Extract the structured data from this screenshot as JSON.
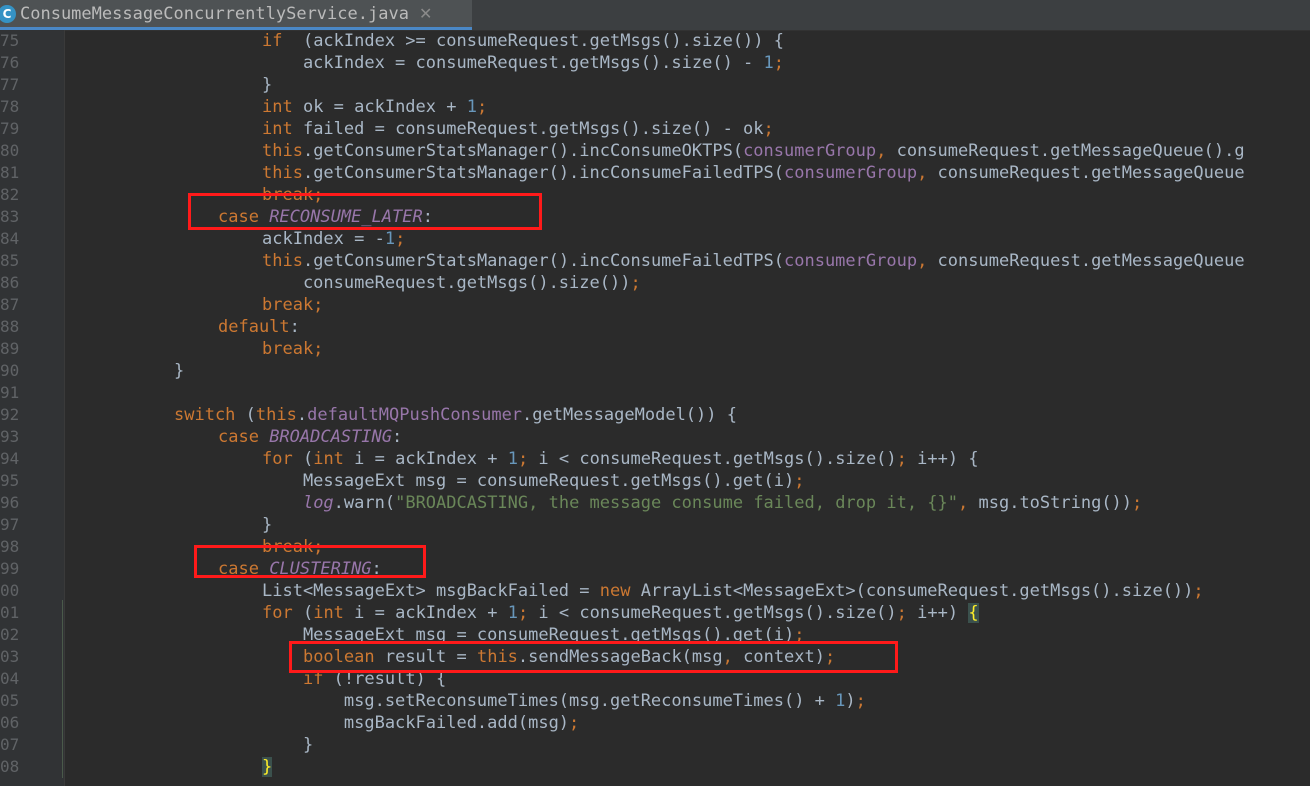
{
  "tab": {
    "icon_letter": "C",
    "filename": "ConsumeMessageConcurrentlyService.java",
    "close_glyph": "✕"
  },
  "line_numbers": [
    "75",
    "76",
    "77",
    "78",
    "79",
    "80",
    "81",
    "82",
    "83",
    "84",
    "85",
    "86",
    "87",
    "88",
    "89",
    "90",
    "91",
    "92",
    "93",
    "94",
    "95",
    "96",
    "97",
    "98",
    "99",
    "00",
    "01",
    "02",
    "03",
    "04",
    "05",
    "06",
    "07",
    "08"
  ],
  "code_lines": [
    [
      [
        "kw",
        "if"
      ],
      [
        "",
        "  (ackIndex >= consumeRequest.getMsgs().size()) {"
      ]
    ],
    [
      [
        "",
        "    ackIndex = consumeRequest.getMsgs().size() - "
      ],
      [
        "num",
        "1"
      ],
      [
        "kw",
        ";"
      ]
    ],
    [
      [
        "",
        "}"
      ]
    ],
    [
      [
        "kw",
        "int"
      ],
      [
        "",
        " ok = ackIndex + "
      ],
      [
        "num",
        "1"
      ],
      [
        "kw",
        ";"
      ]
    ],
    [
      [
        "kw",
        "int"
      ],
      [
        "",
        " failed = consumeRequest.getMsgs().size() - ok"
      ],
      [
        "kw",
        ";"
      ]
    ],
    [
      [
        "kw",
        "this"
      ],
      [
        "",
        ".getConsumerStatsManager().incConsumeOKTPS("
      ],
      [
        "fld",
        "consumerGroup"
      ],
      [
        "kw",
        ","
      ],
      [
        "",
        " consumeRequest.getMessageQueue().g"
      ]
    ],
    [
      [
        "kw",
        "this"
      ],
      [
        "",
        ".getConsumerStatsManager().incConsumeFailedTPS("
      ],
      [
        "fld",
        "consumerGroup"
      ],
      [
        "kw",
        ","
      ],
      [
        "",
        " consumeRequest.getMessageQueue"
      ]
    ],
    [
      [
        "kw",
        "break;"
      ]
    ],
    [
      [
        "kw",
        "case "
      ],
      [
        "ital",
        "RECONSUME_LATER"
      ],
      [
        "",
        ":"
      ]
    ],
    [
      [
        "",
        "ackIndex = -"
      ],
      [
        "num",
        "1"
      ],
      [
        "kw",
        ";"
      ]
    ],
    [
      [
        "kw",
        "this"
      ],
      [
        "",
        ".getConsumerStatsManager().incConsumeFailedTPS("
      ],
      [
        "fld",
        "consumerGroup"
      ],
      [
        "kw",
        ","
      ],
      [
        "",
        " consumeRequest.getMessageQueue"
      ]
    ],
    [
      [
        "",
        "    consumeRequest.getMsgs().size())"
      ],
      [
        "kw",
        ";"
      ]
    ],
    [
      [
        "kw",
        "break;"
      ]
    ],
    [
      [
        "kw",
        "default"
      ],
      [
        "",
        ":"
      ]
    ],
    [
      [
        "kw",
        "break;"
      ]
    ],
    [
      [
        "",
        "}"
      ]
    ],
    [
      [
        "",
        ""
      ]
    ],
    [
      [
        "kw",
        "switch"
      ],
      [
        "",
        " ("
      ],
      [
        "kw",
        "this"
      ],
      [
        "",
        "."
      ],
      [
        "fld",
        "defaultMQPushConsumer"
      ],
      [
        "",
        ".getMessageModel()) {"
      ]
    ],
    [
      [
        "kw",
        "case "
      ],
      [
        "ital",
        "BROADCASTING"
      ],
      [
        "",
        ":"
      ]
    ],
    [
      [
        "kw",
        "for"
      ],
      [
        "",
        " ("
      ],
      [
        "kw",
        "int"
      ],
      [
        "",
        " i = ackIndex + "
      ],
      [
        "num",
        "1"
      ],
      [
        "kw",
        ";"
      ],
      [
        "",
        " i < consumeRequest.getMsgs().size()"
      ],
      [
        "kw",
        ";"
      ],
      [
        "",
        " i++) {"
      ]
    ],
    [
      [
        "",
        "    MessageExt msg = consumeRequest.getMsgs().get(i)"
      ],
      [
        "kw",
        ";"
      ]
    ],
    [
      [
        "",
        "    "
      ],
      [
        "ital",
        "log"
      ],
      [
        "",
        ".warn("
      ],
      [
        "str",
        "\"BROADCASTING, the message consume failed, drop it, {}\""
      ],
      [
        "kw",
        ","
      ],
      [
        "",
        " msg.toString())"
      ],
      [
        "kw",
        ";"
      ]
    ],
    [
      [
        "",
        "}"
      ]
    ],
    [
      [
        "kw",
        "break;"
      ]
    ],
    [
      [
        "kw",
        "case "
      ],
      [
        "ital",
        "CLUSTERING"
      ],
      [
        "",
        ":"
      ]
    ],
    [
      [
        "",
        "List<MessageExt> msgBackFailed = "
      ],
      [
        "kw",
        "new"
      ],
      [
        "",
        " ArrayList<MessageExt>(consumeRequest.getMsgs().size())"
      ],
      [
        "kw",
        ";"
      ]
    ],
    [
      [
        "kw",
        "for"
      ],
      [
        "",
        " ("
      ],
      [
        "kw",
        "int"
      ],
      [
        "",
        " i = ackIndex + "
      ],
      [
        "num",
        "1"
      ],
      [
        "kw",
        ";"
      ],
      [
        "",
        " i < consumeRequest.getMsgs().size()"
      ],
      [
        "kw",
        ";"
      ],
      [
        "",
        " i++) "
      ],
      [
        "brace",
        "{"
      ]
    ],
    [
      [
        "",
        "    MessageExt msg = consumeRequest.getMsgs().get(i)"
      ],
      [
        "kw",
        ";"
      ]
    ],
    [
      [
        "",
        "    "
      ],
      [
        "kw",
        "boolean"
      ],
      [
        "",
        " result = "
      ],
      [
        "kw",
        "this"
      ],
      [
        "",
        ".sendMessageBack(msg"
      ],
      [
        "kw",
        ","
      ],
      [
        "",
        " context)"
      ],
      [
        "kw",
        ";"
      ]
    ],
    [
      [
        "",
        "    "
      ],
      [
        "kw",
        "if"
      ],
      [
        "",
        " (!result) {"
      ]
    ],
    [
      [
        "",
        "        msg.setReconsumeTimes(msg.getReconsumeTimes() + "
      ],
      [
        "num",
        "1"
      ],
      [
        "",
        ")"
      ],
      [
        "kw",
        ";"
      ]
    ],
    [
      [
        "",
        "        msgBackFailed.add(msg)"
      ],
      [
        "kw",
        ";"
      ]
    ],
    [
      [
        "",
        "    }"
      ]
    ],
    [
      [
        "brace",
        "}"
      ]
    ]
  ],
  "colors": {
    "background": "#2b2b2b",
    "keyword": "#cc7832",
    "number": "#6897bb",
    "field": "#9876aa",
    "string": "#6a8759",
    "highlight_box": "#ff1a1a"
  }
}
